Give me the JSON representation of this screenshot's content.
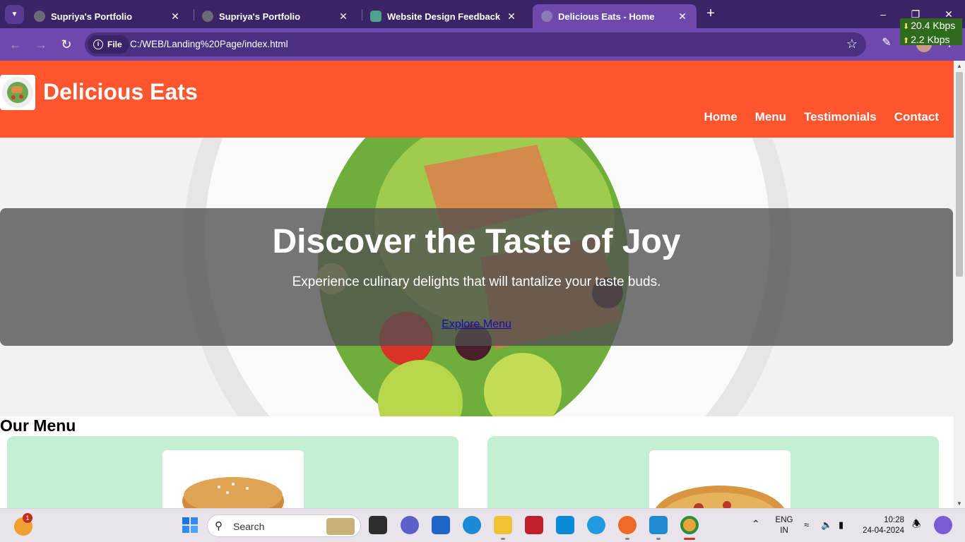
{
  "browser": {
    "tabs": [
      {
        "title": "Supriya's Portfolio",
        "active": false
      },
      {
        "title": "Supriya's Portfolio",
        "active": false
      },
      {
        "title": "Website Design Feedback",
        "active": false
      },
      {
        "title": "Delicious Eats - Home",
        "active": true
      }
    ],
    "url_chip": "File",
    "url": "C:/WEB/Landing%20Page/index.html",
    "net_down": "20.4 Kbps",
    "net_up": "2.2 Kbps"
  },
  "site": {
    "brand": "Delicious Eats",
    "nav": [
      "Home",
      "Menu",
      "Testimonials",
      "Contact"
    ],
    "hero": {
      "title": "Discover the Taste of Joy",
      "subtitle": "Experience culinary delights that will tantalize your taste buds.",
      "cta": "Explore Menu"
    },
    "menu_heading": "Our Menu"
  },
  "taskbar": {
    "search_label": "Search",
    "widget_badge": "1",
    "lang_line1": "ENG",
    "lang_line2": "IN",
    "time": "10:28",
    "date": "24-04-2024"
  },
  "colors": {
    "header": "#ff5630",
    "card": "#c3efd3",
    "browser_frame": "#6e49ad"
  }
}
